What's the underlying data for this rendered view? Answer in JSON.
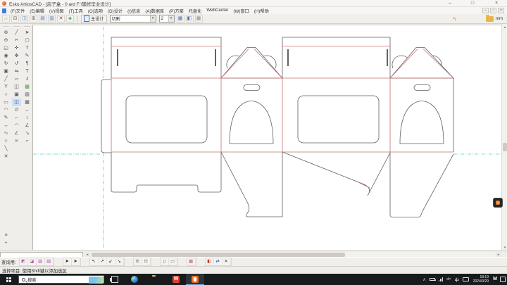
{
  "window": {
    "title": "Esko ArtiosCAD - [房子盒 - 0 ard F:\\辅修毕业设计]",
    "minimize": "–",
    "maximize": "□",
    "close": "×",
    "mdi_minimize": "–",
    "mdi_restore": "▫",
    "mdi_close": "×"
  },
  "menu": [
    "(F)文件",
    "(E)编辑",
    "(V)视图",
    "(T)工具",
    "(O)选项",
    "(D)设计",
    "(I)信息",
    "(A)数据库",
    "(P)方案",
    "托盘化",
    "WebCenter",
    "(W)窗口",
    "(H)帮助"
  ],
  "toolbar": {
    "buttons": [
      {
        "name": "open-button",
        "glyph": "▱",
        "color": "#d9a520"
      },
      {
        "name": "print-button",
        "glyph": "⊟",
        "color": "#666"
      },
      {
        "name": "save-button",
        "glyph": "◫",
        "color": "#5577aa"
      },
      {
        "name": "print-preview-button",
        "glyph": "⊞",
        "color": "#666"
      },
      {
        "name": "copy-pages-button",
        "glyph": "▤",
        "color": "#4a6fb0"
      },
      {
        "name": "paste-pages-button",
        "glyph": "▥",
        "color": "#4a6fb0"
      },
      {
        "name": "close-design-button",
        "glyph": "✕",
        "color": "#884444"
      },
      {
        "name": "color-palette-button",
        "glyph": "◈",
        "color": "#3aa04a"
      }
    ],
    "main_design_label": "主设计",
    "line_type": "切割",
    "pointage": "2",
    "dropdown_arrow": "▾",
    "toggles": [
      {
        "name": "snap-toggle",
        "glyph": "▦",
        "color": "#4a6fb0"
      },
      {
        "name": "layers-toggle",
        "glyph": "◧",
        "color": "#4a6fb0"
      },
      {
        "name": "grid-toggle",
        "glyph": "▦",
        "color": "#888"
      }
    ],
    "undo_glyph": "↰",
    "units": "mm"
  },
  "palettes": {
    "col1": [
      {
        "name": "zoom-in-tool",
        "glyph": "⊕"
      },
      {
        "name": "zoom-out-tool",
        "glyph": "⊖"
      },
      {
        "name": "zoom-window-tool",
        "glyph": "◱"
      },
      {
        "name": "zoom-previous-tool",
        "glyph": "◉"
      },
      {
        "name": "rebuild-tool",
        "glyph": "↻"
      },
      {
        "name": "view-options-tool",
        "glyph": "▣"
      },
      {
        "name": "line-tool",
        "glyph": "╱"
      },
      {
        "name": "polyline-tool",
        "glyph": "Y"
      },
      {
        "name": "circle-tool",
        "glyph": "○"
      },
      {
        "name": "rectangle-tool",
        "glyph": "▭"
      },
      {
        "name": "arc-tool",
        "glyph": "◠"
      },
      {
        "name": "edit-point-tool",
        "glyph": "✎"
      },
      {
        "name": "stretch-tool",
        "glyph": "↔"
      },
      {
        "name": "curve-tool",
        "glyph": "∿"
      },
      {
        "name": "zigzag-tool",
        "glyph": "≈"
      },
      {
        "name": "segment-tool",
        "glyph": "╲"
      },
      {
        "name": "delete-tool",
        "glyph": "✕"
      }
    ],
    "col1x": [
      {
        "name": "layers-tool",
        "glyph": "≡"
      },
      {
        "name": "add-tool",
        "glyph": "+"
      }
    ],
    "col2": [
      {
        "name": "select-line-tool",
        "glyph": "╱"
      },
      {
        "name": "cut-tool",
        "glyph": "✂"
      },
      {
        "name": "align-tool",
        "glyph": "✛"
      },
      {
        "name": "move-tool",
        "glyph": "✥"
      },
      {
        "name": "rotate-tool",
        "glyph": "↺"
      },
      {
        "name": "mirror-tool",
        "glyph": "⇋"
      },
      {
        "name": "offset-tool",
        "glyph": "▱"
      },
      {
        "name": "group-tool",
        "glyph": "◫"
      },
      {
        "name": "copy-tool",
        "glyph": "▣"
      },
      {
        "name": "convert-to-3d-tool",
        "glyph": "◫",
        "color": "#2d5fae",
        "bg": "#cfe0f4"
      },
      {
        "name": "measure-tool",
        "glyph": "∅"
      },
      {
        "name": "trim-tool",
        "glyph": "⌐"
      },
      {
        "name": "fillet-tool",
        "glyph": "◠"
      },
      {
        "name": "chamfer-tool",
        "glyph": "∠"
      },
      {
        "name": "bridge-tool",
        "glyph": "≍"
      }
    ],
    "col3": [
      {
        "name": "select-tool",
        "glyph": "➤"
      },
      {
        "name": "select-group-tool",
        "glyph": "▢"
      },
      {
        "name": "text-tool",
        "glyph": "T"
      },
      {
        "name": "text-edit-tool",
        "glyph": "✎"
      },
      {
        "name": "paragraph-tool",
        "glyph": "¶"
      },
      {
        "name": "text-style-tool",
        "glyph": "T"
      },
      {
        "name": "italic-text-tool",
        "glyph": "J"
      },
      {
        "name": "fill-tool",
        "glyph": "▩",
        "color": "#5a9a5a"
      },
      {
        "name": "hatch-tool",
        "glyph": "▨"
      },
      {
        "name": "image-tool",
        "glyph": "▦"
      },
      {
        "name": "dimension-horizontal-tool",
        "glyph": "↔"
      },
      {
        "name": "dimension-vertical-tool",
        "glyph": "↕"
      },
      {
        "name": "dimension-angle-tool",
        "glyph": "∠"
      },
      {
        "name": "dimension-arrow-tool",
        "glyph": "↘"
      },
      {
        "name": "leader-tool",
        "glyph": "⌐"
      }
    ]
  },
  "bottom_toolbar": {
    "label": "查询用:",
    "g1": [
      {
        "name": "snap-endpoint-button",
        "glyph": "◩",
        "color": "#b05ab0"
      },
      {
        "name": "snap-midpoint-button",
        "glyph": "◪",
        "color": "#b05ab0"
      },
      {
        "name": "snap-intersection-button",
        "glyph": "▨",
        "color": "#b05ab0"
      },
      {
        "name": "snap-center-button",
        "glyph": "▧",
        "color": "#b05ab0"
      }
    ],
    "g2": [
      {
        "name": "select-item-button",
        "glyph": "➤",
        "color": "#222"
      },
      {
        "name": "select-add-button",
        "glyph": "➤",
        "color": "#222"
      }
    ],
    "g3": [
      {
        "name": "select-point-button",
        "glyph": "↖",
        "color": "#222"
      },
      {
        "name": "select-line-button",
        "glyph": "↗",
        "color": "#222"
      },
      {
        "name": "select-arc-button",
        "glyph": "↙",
        "color": "#222"
      },
      {
        "name": "select-all-button",
        "glyph": "↘",
        "color": "#222"
      }
    ],
    "g4": [
      {
        "name": "grid-snap-button",
        "glyph": "⊞",
        "color": "#6a8a6a"
      },
      {
        "name": "grid-show-button",
        "glyph": "⊟",
        "color": "#6a8a6a"
      }
    ],
    "g5": [
      {
        "name": "window-select-button",
        "glyph": "▯",
        "color": "#55678a"
      },
      {
        "name": "crossing-select-button",
        "glyph": "▭",
        "color": "#55678a"
      }
    ],
    "g6": [
      {
        "name": "highlight-button",
        "glyph": "▩",
        "color": "#c05a8a"
      }
    ],
    "g7": [
      {
        "name": "layer-red-button",
        "glyph": "◧",
        "color": "#c0392b"
      },
      {
        "name": "swap-button",
        "glyph": "⇄",
        "color": "#3a5fa0"
      },
      {
        "name": "clear-button",
        "glyph": "✕",
        "color": "#444"
      }
    ]
  },
  "scroll": {
    "up": "▴",
    "down": "▾",
    "left": "◂",
    "right": "▸"
  },
  "status_bar": {
    "text": "选择项目: 使用Shift键以添加选区"
  },
  "taskbar": {
    "search_placeholder": "搜索",
    "wps_label": "W",
    "ime": "中",
    "m_logo": "M",
    "time": "18:19",
    "date": "2024/3/29",
    "tray_chevron": "∧",
    "volume_muted": "d×"
  },
  "colors": {
    "cut_line": "#5f5f5f",
    "crease_line": "#c4706e",
    "guide_line": "#64c6c9",
    "canvas": "#ffffff",
    "chrome": "#f0eeea",
    "taskbar": "#191a1c"
  }
}
